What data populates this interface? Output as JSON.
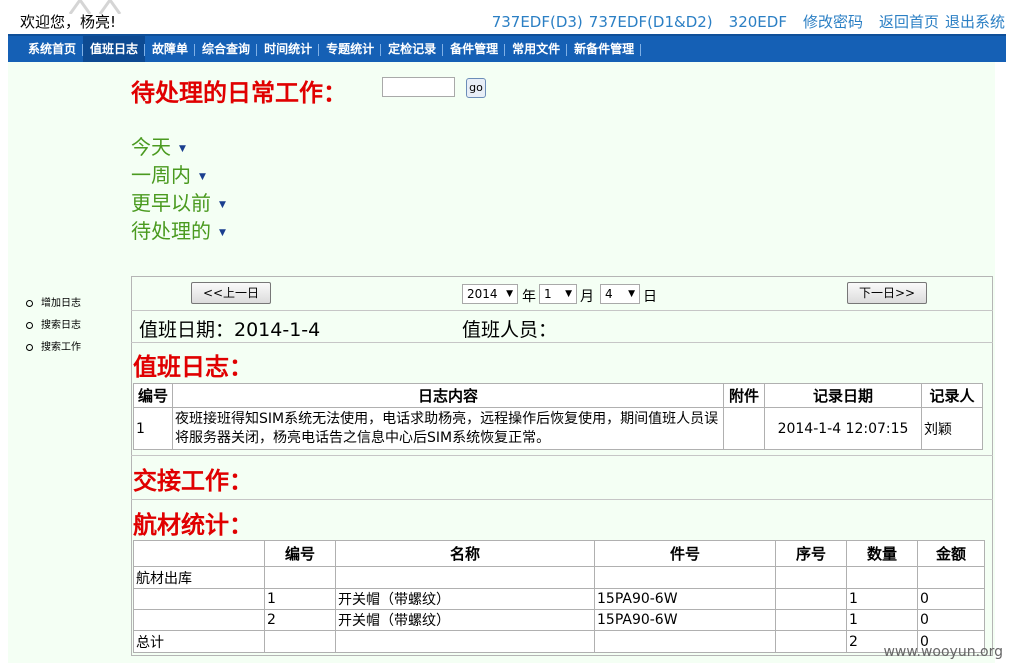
{
  "header": {
    "welcome": "欢迎您，杨亮!",
    "links": [
      "737EDF(D3)",
      "737EDF(D1&D2)",
      "320EDF",
      "修改密码",
      "返回首页",
      "退出系统"
    ]
  },
  "nav": {
    "items": [
      "系统首页",
      "值班日志",
      "故障单",
      "综合查询",
      "时间统计",
      "专题统计",
      "定检记录",
      "备件管理",
      "常用文件",
      "新备件管理"
    ],
    "active_index": 1
  },
  "sidebar": {
    "items": [
      "增加日志",
      "搜索日志",
      "搜索工作"
    ]
  },
  "pending": {
    "title": "待处理的日常工作：",
    "input_value": "",
    "go_label": "go",
    "groups": [
      "今天",
      "一周内",
      "更早以前",
      "待处理的"
    ]
  },
  "date_nav": {
    "prev_label": "<<上一日",
    "next_label": "下一日>>",
    "year": "2014",
    "year_unit": "年",
    "month": "1",
    "month_unit": "月",
    "day": "4",
    "day_unit": "日"
  },
  "duty": {
    "date_label": "值班日期：2014-1-4",
    "person_label": "值班人员："
  },
  "duty_log": {
    "title": "值班日志：",
    "headers": [
      "编号",
      "日志内容",
      "附件",
      "记录日期",
      "记录人"
    ],
    "rows": [
      {
        "no": "1",
        "content": "夜班接班得知SIM系统无法使用，电话求助杨亮，远程操作后恢复使用，期间值班人员误将服务器关闭，杨亮电话告之信息中心后SIM系统恢复正常。",
        "attachment": "",
        "date": "2014-1-4 12:07:15",
        "recorder": "刘颖"
      }
    ]
  },
  "handover": {
    "title": "交接工作："
  },
  "materials": {
    "title": "航材统计：",
    "headers": [
      "",
      "编号",
      "名称",
      "件号",
      "序号",
      "数量",
      "金额"
    ],
    "section_label": "航材出库",
    "rows": [
      {
        "no": "1",
        "name": "开关帽（带螺纹）",
        "part": "15PA90-6W",
        "serial": "",
        "qty": "1",
        "amount": "0"
      },
      {
        "no": "2",
        "name": "开关帽（带螺纹）",
        "part": "15PA90-6W",
        "serial": "",
        "qty": "1",
        "amount": "0"
      }
    ],
    "total_label": "总计",
    "total_qty": "2",
    "total_amount": "0"
  },
  "watermark": "www.wooyun.org"
}
